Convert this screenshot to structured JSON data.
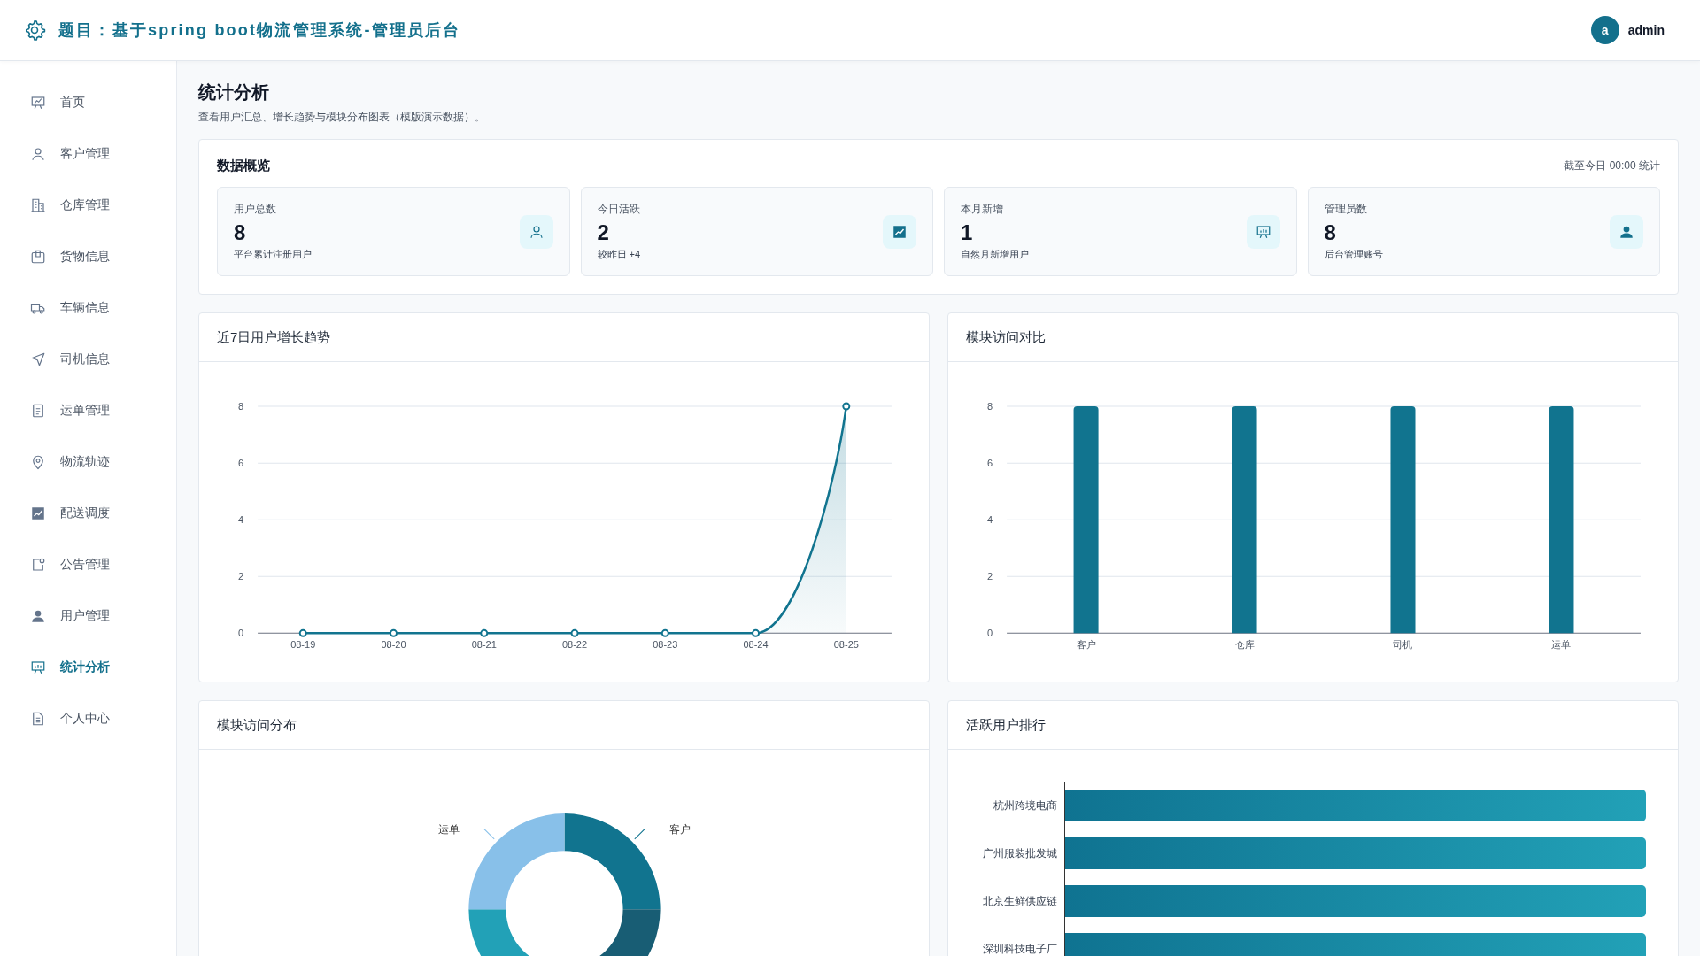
{
  "header": {
    "title": "题目：基于spring boot物流管理系统-管理员后台",
    "user": {
      "avatar": "a",
      "name": "admin"
    }
  },
  "sidebar": {
    "items": [
      {
        "label": "首页",
        "selected": false
      },
      {
        "label": "客户管理",
        "selected": false
      },
      {
        "label": "仓库管理",
        "selected": false
      },
      {
        "label": "货物信息",
        "selected": false
      },
      {
        "label": "车辆信息",
        "selected": false
      },
      {
        "label": "司机信息",
        "selected": false
      },
      {
        "label": "运单管理",
        "selected": false
      },
      {
        "label": "物流轨迹",
        "selected": false
      },
      {
        "label": "配送调度",
        "selected": false
      },
      {
        "label": "公告管理",
        "selected": false
      },
      {
        "label": "用户管理",
        "selected": false
      },
      {
        "label": "统计分析",
        "selected": true
      },
      {
        "label": "个人中心",
        "selected": false
      }
    ]
  },
  "page": {
    "title": "统计分析",
    "subtitle": "查看用户汇总、增长趋势与模块分布图表（模版演示数据）。"
  },
  "overview": {
    "title": "数据概览",
    "note": "截至今日 00:00 统计",
    "stats": [
      {
        "label": "用户总数",
        "value": "8",
        "note": "平台累计注册用户"
      },
      {
        "label": "今日活跃",
        "value": "2",
        "note": "较昨日 +4"
      },
      {
        "label": "本月新增",
        "value": "1",
        "note": "自然月新增用户"
      },
      {
        "label": "管理员数",
        "value": "8",
        "note": "后台管理账号"
      }
    ]
  },
  "growth_chart": {
    "title": "近7日用户增长趋势",
    "chart_data": {
      "type": "area",
      "categories": [
        "08-19",
        "08-20",
        "08-21",
        "08-22",
        "08-23",
        "08-24",
        "08-25"
      ],
      "grid": true,
      "series": [
        {
          "color": "#11748f",
          "values": [
            0,
            0,
            0,
            0,
            0,
            0,
            8
          ]
        }
      ],
      "ylim": [
        0,
        8
      ],
      "yticks": [
        0,
        2,
        4,
        6,
        8
      ]
    }
  },
  "module_chart": {
    "title": "模块访问对比",
    "chart_data": {
      "type": "bar",
      "categories": [
        "客户",
        "仓库",
        "司机",
        "运单"
      ],
      "grid": true,
      "series": [
        {
          "color": "#11748f",
          "values": [
            8,
            8,
            8,
            8
          ]
        }
      ],
      "ylim": [
        0,
        8
      ],
      "yticks": [
        0,
        2,
        4,
        6,
        8
      ]
    }
  },
  "distribution_chart": {
    "title": "模块访问分布",
    "chart_data": {
      "type": "donut",
      "categories": [
        "客户",
        null,
        null,
        "运单"
      ],
      "values": [
        25,
        25,
        25,
        25
      ]
    }
  },
  "ranking": {
    "title": "活跃用户排行",
    "rows": [
      {
        "name": "杭州跨境电商"
      },
      {
        "name": "广州服装批发城"
      },
      {
        "name": "北京生鲜供应链"
      },
      {
        "name": "深圳科技电子厂"
      }
    ]
  }
}
